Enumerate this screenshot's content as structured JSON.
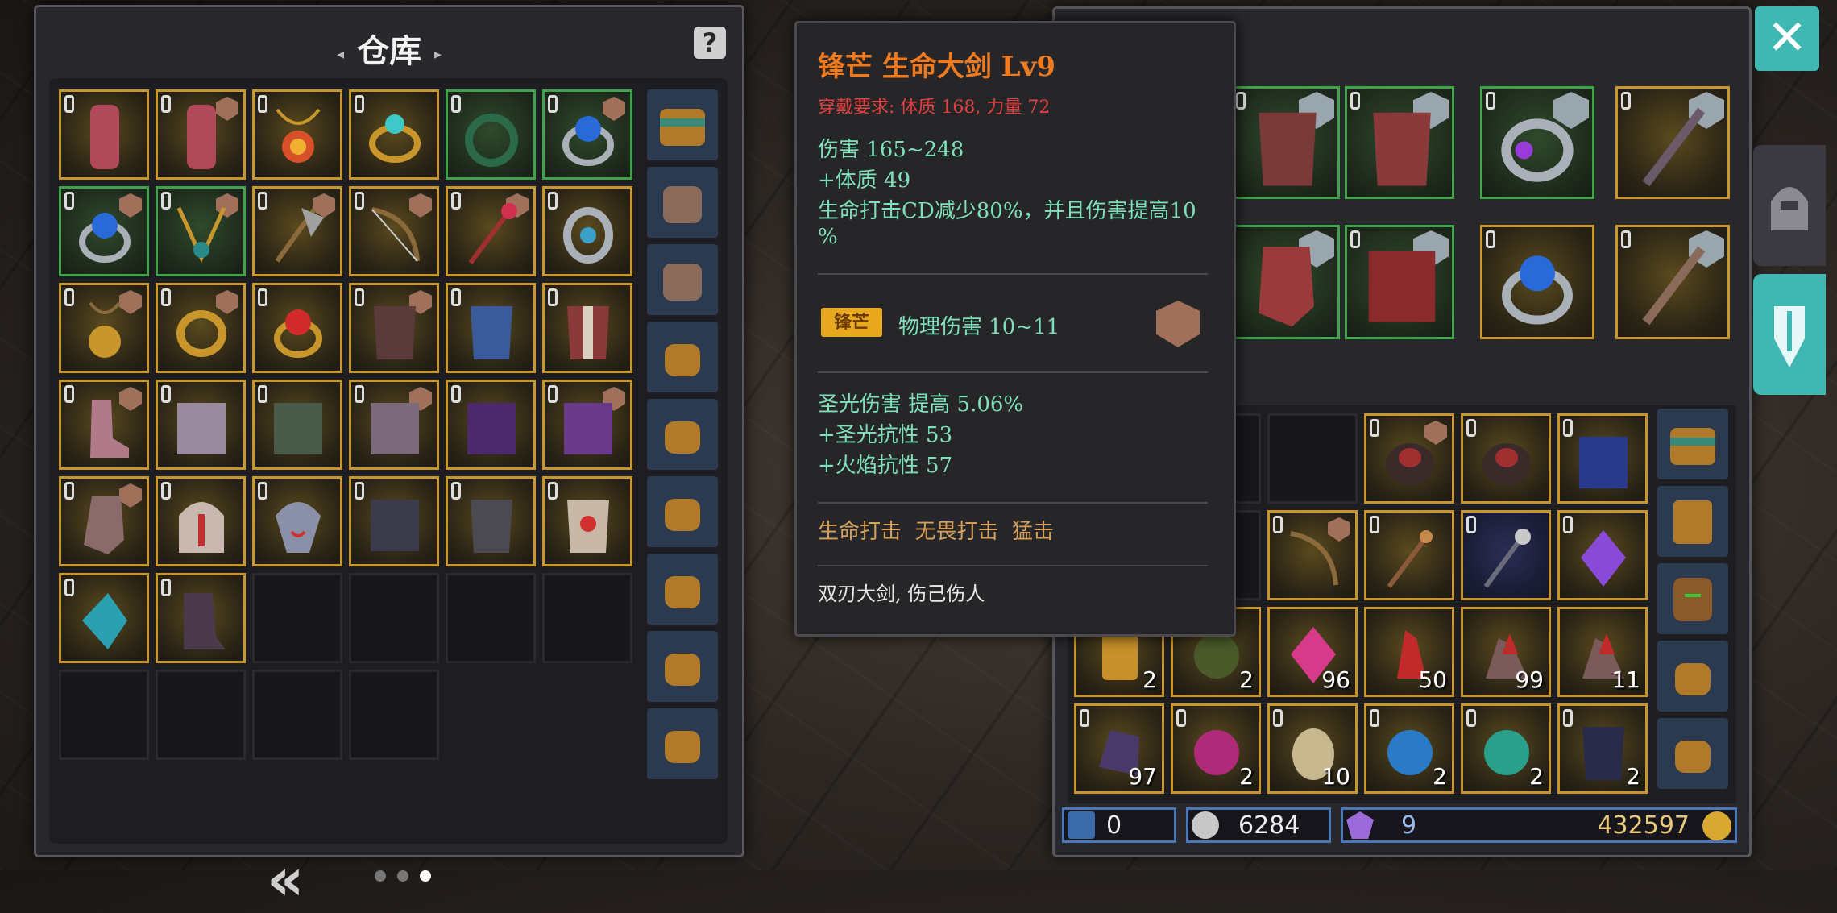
{
  "warehouse": {
    "title": "仓库",
    "help_label": "?",
    "back_label": "«",
    "page_count": 3,
    "current_page": 3
  },
  "tooltip": {
    "name": "锋芒 生命大剑 Lv9",
    "requirement": "穿戴要求: 体质 168, 力量 72",
    "damage": "伤害 165~248",
    "stat1": "+体质 49",
    "effect_line1": "生命打击CD减少80%，并且伤害提高10",
    "effect_line2": "%",
    "affix_badge": "锋芒",
    "affix_stat": "物理伤害 10~11",
    "bonus1": "圣光伤害 提高 5.06%",
    "bonus2": "+圣光抗性 53",
    "bonus3": "+火焰抗性 57",
    "skills": "生命打击  无畏打击  猛击",
    "flavor": "双刃大剑, 伤己伤人"
  },
  "backpack_counts": {
    "r3": [
      "2",
      "2",
      "96",
      "50",
      "99",
      "11"
    ],
    "r4": [
      "97",
      "2",
      "10",
      "2",
      "2",
      "2"
    ]
  },
  "currency": {
    "gems": "0",
    "crystals": "6284",
    "shards": "9",
    "gold": "432597"
  },
  "close_label": "✕",
  "colors": {
    "rarity_gold": "#c9962c",
    "rarity_green": "#3fa34a",
    "accent_teal": "#3fb8b4",
    "name_orange": "#f07a20",
    "stat_teal": "#7de0b8"
  },
  "icons": [
    "question-icon",
    "chevron-left-double-icon",
    "close-icon",
    "helmet-icon",
    "sword-icon",
    "lock-icon",
    "rank-shield-icon",
    "bag-icon"
  ]
}
